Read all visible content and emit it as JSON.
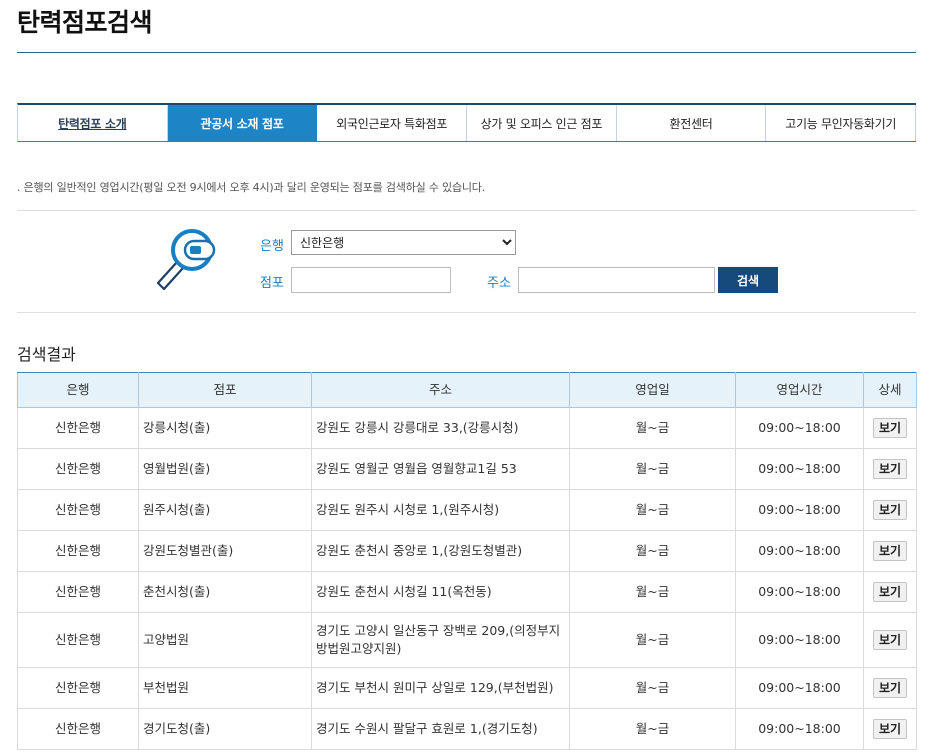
{
  "page": {
    "title": "탄력점포검색"
  },
  "tabs": {
    "active_index": 1,
    "items": [
      {
        "label": "탄력점포 소개"
      },
      {
        "label": "관공서 소재 점포"
      },
      {
        "label": "외국인근로자 특화점포"
      },
      {
        "label": "상가 및 오피스 인근 점포"
      },
      {
        "label": "환전센터"
      },
      {
        "label": "고기능 무인자동화기기"
      }
    ]
  },
  "intro": {
    "text": ". 은행의 일반적인 영업시간(평일 오전 9시에서 오후 4시)과 달리 운영되는 점포를 검색하실 수 있습니다."
  },
  "search": {
    "icon": "magnifier-icon",
    "bank": {
      "label": "은행",
      "selected": "신한은행"
    },
    "branch": {
      "label": "점포",
      "value": ""
    },
    "address": {
      "label": "주소",
      "value": ""
    },
    "button": "검색"
  },
  "results": {
    "heading": "검색결과",
    "columns": [
      "은행",
      "점포",
      "주소",
      "영업일",
      "영업시간",
      "상세"
    ],
    "rows": [
      {
        "bank": "신한은행",
        "branch": "강릉시청(출)",
        "address": "강원도 강릉시 강릉대로 33,(강릉시청)",
        "days": "월~금",
        "hours": "09:00~18:00",
        "detail": "보기"
      },
      {
        "bank": "신한은행",
        "branch": "영월법원(출)",
        "address": "강원도 영월군 영월읍 영월향교1길 53",
        "days": "월~금",
        "hours": "09:00~18:00",
        "detail": "보기"
      },
      {
        "bank": "신한은행",
        "branch": "원주시청(출)",
        "address": "강원도 원주시 시청로 1,(원주시청)",
        "days": "월~금",
        "hours": "09:00~18:00",
        "detail": "보기"
      },
      {
        "bank": "신한은행",
        "branch": "강원도청별관(출)",
        "address": "강원도 춘천시 중앙로 1,(강원도청별관)",
        "days": "월~금",
        "hours": "09:00~18:00",
        "detail": "보기"
      },
      {
        "bank": "신한은행",
        "branch": "춘천시청(출)",
        "address": "강원도 춘천시 시청길 11(옥천동)",
        "days": "월~금",
        "hours": "09:00~18:00",
        "detail": "보기"
      },
      {
        "bank": "신한은행",
        "branch": "고양법원",
        "address": "경기도 고양시 일산동구 장백로 209,(의정부지방법원고양지원)",
        "days": "월~금",
        "hours": "09:00~18:00",
        "detail": "보기"
      },
      {
        "bank": "신한은행",
        "branch": "부천법원",
        "address": "경기도 부천시 원미구 상일로 129,(부천법원)",
        "days": "월~금",
        "hours": "09:00~18:00",
        "detail": "보기"
      },
      {
        "bank": "신한은행",
        "branch": "경기도청(출)",
        "address": "경기도 수원시 팔달구 효원로 1,(경기도청)",
        "days": "월~금",
        "hours": "09:00~18:00",
        "detail": "보기"
      }
    ]
  },
  "colors": {
    "accent": "#1d84c6",
    "navy": "#174a7c",
    "label": "#1a7fc1",
    "rule": "#2b6181",
    "header_bg": "#e6f2f9"
  }
}
